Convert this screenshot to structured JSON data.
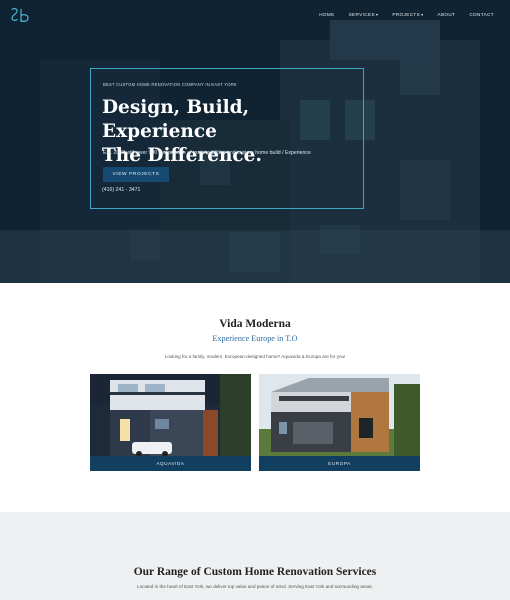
{
  "brand": {
    "logo_text": "sb"
  },
  "nav": {
    "items": [
      {
        "label": "HOME",
        "has_dropdown": false
      },
      {
        "label": "SERVICES",
        "has_dropdown": true
      },
      {
        "label": "PROJECTS",
        "has_dropdown": true
      },
      {
        "label": "ABOUT",
        "has_dropdown": false
      },
      {
        "label": "CONTACT",
        "has_dropdown": false
      }
    ],
    "dropdown_glyph": "▾"
  },
  "hero": {
    "tagline": "BEST CUSTOM HOME RENOVATION COMPANY IN EAST YORK",
    "title_line1": "Design, Build, Experience",
    "title_line2": "The Difference.",
    "subtitle": "Est. 2003 with over 900 thousand ft. of major addition and custom home build / Experience",
    "button_label": "VIEW PROJECTS",
    "phone": "(416) 241 - 3471"
  },
  "vida": {
    "title": "Vida Moderna",
    "subtitle": "Experience Europe in T.O",
    "description": "Looking for a family, modern, European-designed home? Aquavida & Europa are for you!",
    "cards": [
      {
        "label": "AQUAVIDA"
      },
      {
        "label": "EUROPA"
      }
    ]
  },
  "services": {
    "title": "Our Range of Custom Home Renovation Services",
    "description": "Located in the heart of East York, we deliver top value and peace of mind. Serving East York and surrounding areas."
  },
  "colors": {
    "accent": "#3ea7c2",
    "button_bg": "#164a70",
    "card_label_bg": "#123e60",
    "subtitle_blue": "#2e6da4"
  }
}
